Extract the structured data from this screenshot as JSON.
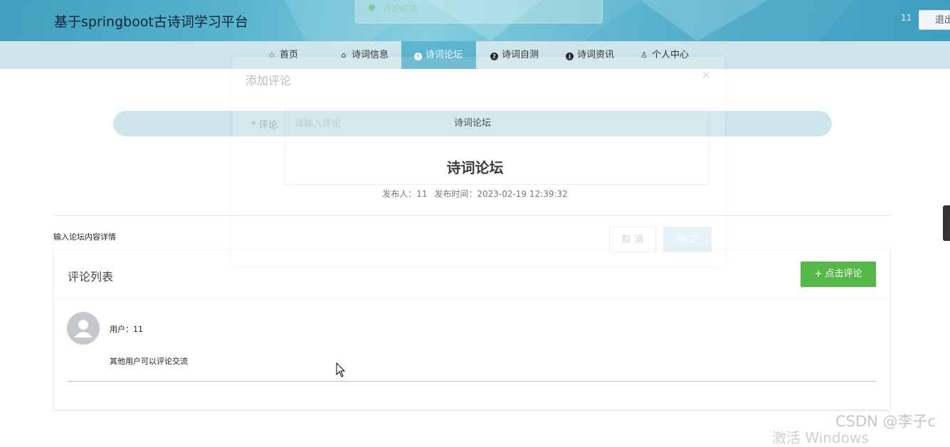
{
  "header": {
    "site_title": "基于springboot古诗词学习平台",
    "user_name": "11",
    "logout_label": "退出"
  },
  "toast": {
    "message": "评论成功"
  },
  "nav": {
    "items": [
      {
        "label": "首页",
        "icon": "star-icon"
      },
      {
        "label": "诗词信息",
        "icon": "bag-icon"
      },
      {
        "label": "诗词论坛",
        "icon": "info-circle-icon",
        "active": true
      },
      {
        "label": "诗词自测",
        "icon": "question-circle-icon"
      },
      {
        "label": "诗词资讯",
        "icon": "info-circle-icon"
      },
      {
        "label": "个人中心",
        "icon": "user-icon"
      }
    ]
  },
  "breadcrumb": {
    "label": "诗词论坛"
  },
  "post": {
    "title": "诗词论坛",
    "author_label": "发布人：11",
    "time_label": "发布时间：2023-02-19 12:39:32",
    "content_label": "输入论坛内容详情"
  },
  "comments": {
    "panel_title": "评论列表",
    "add_button": "+ 点击评论",
    "items": [
      {
        "user": "用户：11",
        "text": "其他用户可以评论交流"
      }
    ]
  },
  "modal": {
    "title": "添加评论",
    "close": "×",
    "field_label": "* 评论",
    "placeholder": "请输入评论",
    "cancel": "取 消",
    "confirm": "确 定"
  },
  "watermark": "CSDN @李子c",
  "os_watermark": "激活 Windows"
}
